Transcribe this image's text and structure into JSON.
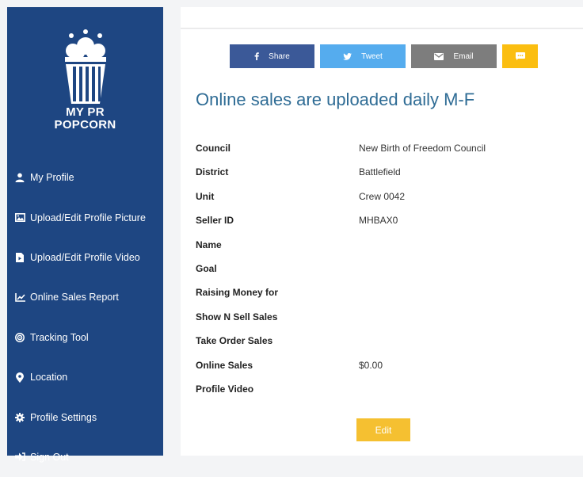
{
  "sidebar": {
    "logo_line1": "MY PR",
    "logo_line2": "POPCORN",
    "items": [
      {
        "label": "My Profile",
        "icon": "user-icon"
      },
      {
        "label": "Upload/Edit Profile Picture",
        "icon": "image-icon"
      },
      {
        "label": "Upload/Edit Profile Video",
        "icon": "video-file-icon"
      },
      {
        "label": "Online Sales Report",
        "icon": "line-chart-icon"
      },
      {
        "label": "Tracking Tool",
        "icon": "target-icon"
      },
      {
        "label": "Location",
        "icon": "map-pin-icon"
      },
      {
        "label": "Profile Settings",
        "icon": "gear-icon"
      },
      {
        "label": "Sign Out",
        "icon": "sign-out-icon"
      }
    ]
  },
  "share": {
    "facebook_label": "Share",
    "twitter_label": "Tweet",
    "email_label": "Email"
  },
  "main": {
    "heading": "Online sales are uploaded daily M-F",
    "rows": [
      {
        "label": "Council",
        "value": "New Birth of Freedom Council"
      },
      {
        "label": "District",
        "value": "Battlefield"
      },
      {
        "label": "Unit",
        "value": "Crew 0042"
      },
      {
        "label": "Seller ID",
        "value": "MHBAX0"
      },
      {
        "label": "Name",
        "value": ""
      },
      {
        "label": "Goal",
        "value": ""
      },
      {
        "label": "Raising Money for",
        "value": ""
      },
      {
        "label": "Show N Sell Sales",
        "value": ""
      },
      {
        "label": "Take Order Sales",
        "value": ""
      },
      {
        "label": "Online Sales",
        "value": "$0.00"
      },
      {
        "label": "Profile Video",
        "value": ""
      }
    ],
    "edit_label": "Edit"
  },
  "colors": {
    "sidebar_bg": "#1e4682",
    "heading": "#2f6c95",
    "facebook": "#3b5998",
    "twitter": "#55acee",
    "email": "#7d7d7d",
    "sms": "#fbbe10",
    "edit": "#f5c031"
  }
}
